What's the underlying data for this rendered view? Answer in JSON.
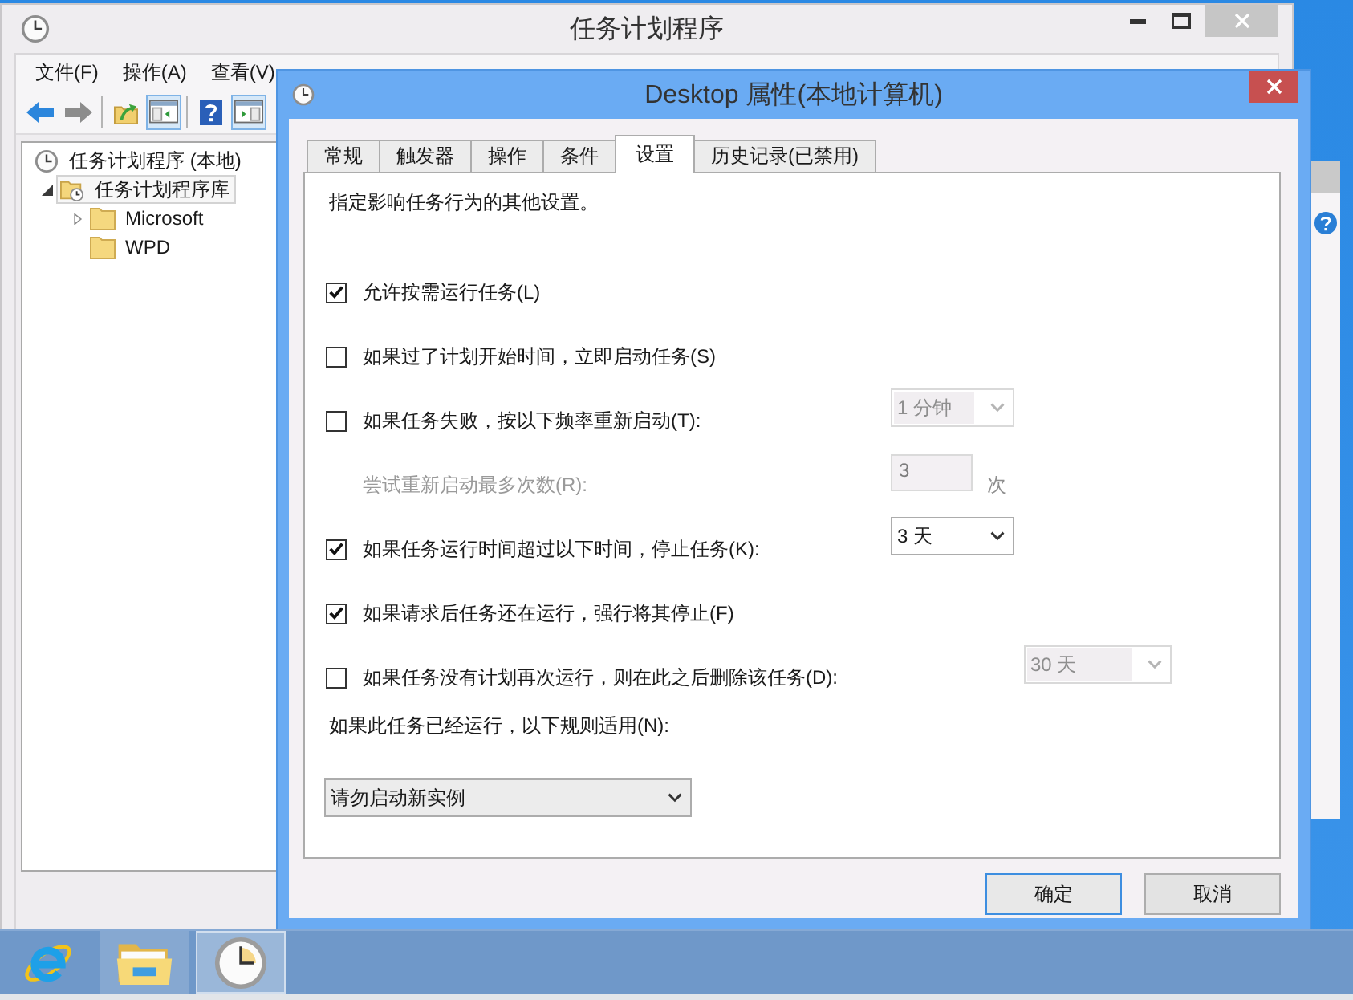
{
  "main_window": {
    "title": "任务计划程序",
    "menu": [
      "文件(F)",
      "操作(A)",
      "查看(V)"
    ],
    "toolbar": [
      [
        {
          "kind": "back",
          "on": false,
          "disabled": false
        },
        {
          "kind": "forward",
          "on": false,
          "disabled": true
        }
      ],
      [
        {
          "kind": "up",
          "on": false,
          "disabled": false
        },
        {
          "kind": "console_tree",
          "on": true,
          "disabled": false
        }
      ],
      [
        {
          "kind": "help",
          "on": false,
          "disabled": false
        },
        {
          "kind": "action_pane",
          "on": true,
          "disabled": false
        }
      ]
    ],
    "tree": [
      {
        "label": "任务计划程序 (本地)",
        "kind": "root",
        "selected": false,
        "children": [
          {
            "label": "任务计划程序库",
            "kind": "library",
            "selected": true,
            "expanded": true,
            "children": [
              {
                "label": "Microsoft",
                "kind": "folder",
                "selected": false,
                "expanded": false
              },
              {
                "label": "WPD",
                "kind": "folder",
                "selected": false
              }
            ]
          }
        ]
      }
    ]
  },
  "dialog": {
    "title": "Desktop 属性(本地计算机)",
    "tabs": [
      {
        "label": "常规",
        "selected": false
      },
      {
        "label": "触发器",
        "selected": false
      },
      {
        "label": "操作",
        "selected": false
      },
      {
        "label": "条件",
        "selected": false
      },
      {
        "label": "设置",
        "selected": true
      },
      {
        "label": "历史记录(已禁用)",
        "selected": false
      }
    ],
    "description": "指定影响任务行为的其他设置。",
    "options": [
      {
        "kind": "checkbox",
        "label": "允许按需运行任务(L)",
        "checked": true
      },
      {
        "kind": "checkbox",
        "label": "如果过了计划开始时间，立即启动任务(S)",
        "checked": false
      },
      {
        "kind": "checkbox",
        "label": "如果任务失败，按以下频率重新启动(T):",
        "checked": false,
        "control": {
          "kind": "dropdown",
          "value": "1 分钟",
          "disabled": true
        }
      },
      {
        "kind": "count",
        "label": "尝试重新启动最多次数(R):",
        "disabled": true,
        "control": {
          "kind": "input",
          "value": "3",
          "disabled": true,
          "unit": "次"
        }
      },
      {
        "kind": "checkbox",
        "label": "如果任务运行时间超过以下时间，停止任务(K):",
        "checked": true,
        "control": {
          "kind": "dropdown",
          "value": "3 天",
          "disabled": false
        }
      },
      {
        "kind": "checkbox",
        "label": "如果请求后任务还在运行，强行将其停止(F)",
        "checked": true
      },
      {
        "kind": "checkbox",
        "label": "如果任务没有计划再次运行，则在此之后删除该任务(D):",
        "checked": false,
        "control": {
          "kind": "dropdown",
          "value": "30 天",
          "disabled": true
        }
      }
    ],
    "rule_label": "如果此任务已经运行，以下规则适用(N):",
    "rule_dropdown": {
      "value": "请勿启动新实例"
    },
    "buttons": [
      {
        "label": "确定",
        "default": true
      },
      {
        "label": "取消",
        "default": false
      }
    ]
  },
  "taskbar": [
    {
      "kind": "browser",
      "running": false,
      "selected": false
    },
    {
      "kind": "explorer",
      "running": true,
      "selected": false
    },
    {
      "kind": "scheduler",
      "running": true,
      "selected": true
    }
  ]
}
